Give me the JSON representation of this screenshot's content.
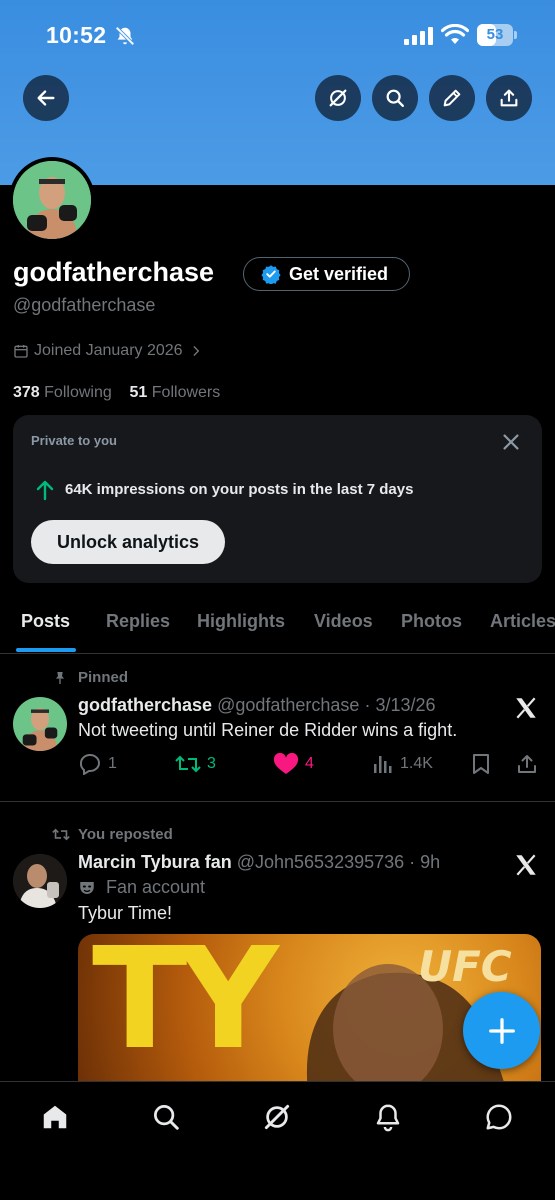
{
  "status_bar": {
    "time": "10:52",
    "battery": "53",
    "battery_level": 0.53
  },
  "profile": {
    "name": "godfatherchase",
    "handle": "@godfatherchase",
    "get_verified_label": "Get verified",
    "joined": "Joined January 2026",
    "following_count": "378",
    "following_label": "Following",
    "followers_count": "51",
    "followers_label": "Followers"
  },
  "analytics_card": {
    "private_label": "Private to you",
    "impressions_text": "64K impressions on your posts in the last 7 days",
    "unlock_label": "Unlock analytics"
  },
  "tabs": [
    {
      "label": "Posts",
      "active": true
    },
    {
      "label": "Replies"
    },
    {
      "label": "Highlights"
    },
    {
      "label": "Videos"
    },
    {
      "label": "Photos"
    },
    {
      "label": "Articles"
    }
  ],
  "posts": [
    {
      "context": "Pinned",
      "author": "godfatherchase",
      "handle": "@godfatherchase",
      "date": "· 3/13/26",
      "text": "Not tweeting until Reiner de Ridder wins a fight.",
      "replies": "1",
      "reposts": "3",
      "likes": "4",
      "views": "1.4K"
    },
    {
      "context": "You reposted",
      "author": "Marcin Tybura fan",
      "handle": "@John56532395736",
      "date": "· 9h",
      "badge": "Fan account",
      "text": "Tybur Time!",
      "media_text_left": "TY",
      "media_text_right": "UFC"
    }
  ],
  "colors": {
    "accent": "#1d9bf0",
    "repost": "#00ba7c",
    "like": "#f91880",
    "banner": "#4c9be6"
  },
  "icons": [
    "back-arrow-icon",
    "grok-icon",
    "search-icon",
    "edit-icon",
    "share-icon",
    "verified-icon",
    "calendar-icon",
    "chevron-right-icon",
    "close-icon",
    "arrow-up-icon",
    "pin-icon",
    "x-logo-icon",
    "reply-icon",
    "repost-icon",
    "heart-icon",
    "views-icon",
    "bookmark-icon",
    "mask-icon",
    "plus-icon",
    "home-icon",
    "bell-icon",
    "chat-icon"
  ]
}
